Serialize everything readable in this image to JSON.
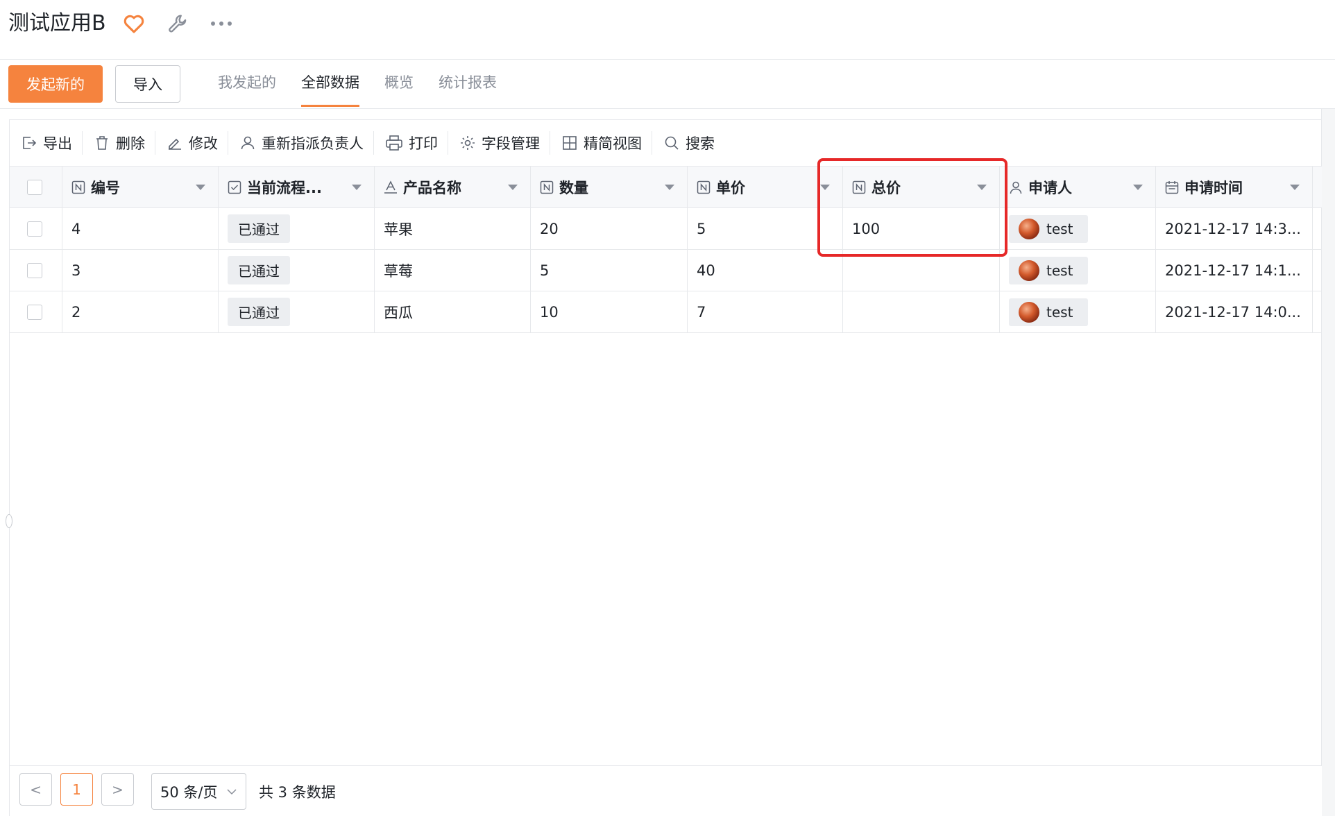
{
  "header": {
    "app_title": "测试应用B",
    "favorite_color": "#f5833e"
  },
  "tabbar": {
    "primary_button": "发起新的",
    "import_button": "导入",
    "tabs": [
      {
        "label": "我发起的",
        "active": false
      },
      {
        "label": "全部数据",
        "active": true
      },
      {
        "label": "概览",
        "active": false
      },
      {
        "label": "统计报表",
        "active": false
      }
    ],
    "accent_color": "#f5833e"
  },
  "toolbar": {
    "items": [
      {
        "label": "导出",
        "icon": "export-icon"
      },
      {
        "label": "删除",
        "icon": "trash-icon"
      },
      {
        "label": "修改",
        "icon": "edit-icon"
      },
      {
        "label": "重新指派负责人",
        "icon": "user-icon"
      },
      {
        "label": "打印",
        "icon": "printer-icon"
      },
      {
        "label": "字段管理",
        "icon": "gear-icon"
      },
      {
        "label": "精简视图",
        "icon": "grid-icon"
      },
      {
        "label": "搜索",
        "icon": "search-icon"
      }
    ]
  },
  "table": {
    "columns": [
      {
        "label": "编号",
        "icon": "number-field-icon"
      },
      {
        "label": "当前流程...",
        "icon": "checkbox-field-icon"
      },
      {
        "label": "产品名称",
        "icon": "text-field-icon"
      },
      {
        "label": "数量",
        "icon": "number-field-icon"
      },
      {
        "label": "单价",
        "icon": "number-field-icon"
      },
      {
        "label": "总价",
        "icon": "number-field-icon"
      },
      {
        "label": "申请人",
        "icon": "user-field-icon"
      },
      {
        "label": "申请时间",
        "icon": "calendar-field-icon"
      }
    ],
    "rows": [
      {
        "id": "4",
        "status": "已通过",
        "product": "苹果",
        "quantity": "20",
        "unit_price": "5",
        "total": "100",
        "applicant": "test",
        "time": "2021-12-17 14:3..."
      },
      {
        "id": "3",
        "status": "已通过",
        "product": "草莓",
        "quantity": "5",
        "unit_price": "40",
        "total": "",
        "applicant": "test",
        "time": "2021-12-17 14:1..."
      },
      {
        "id": "2",
        "status": "已通过",
        "product": "西瓜",
        "quantity": "10",
        "unit_price": "7",
        "total": "",
        "applicant": "test",
        "time": "2021-12-17 14:0..."
      }
    ],
    "highlight_color": "#e62828"
  },
  "pagination": {
    "prev": "<",
    "current_page": "1",
    "next": ">",
    "page_size": "50 条/页",
    "total_text": "共 3 条数据"
  }
}
